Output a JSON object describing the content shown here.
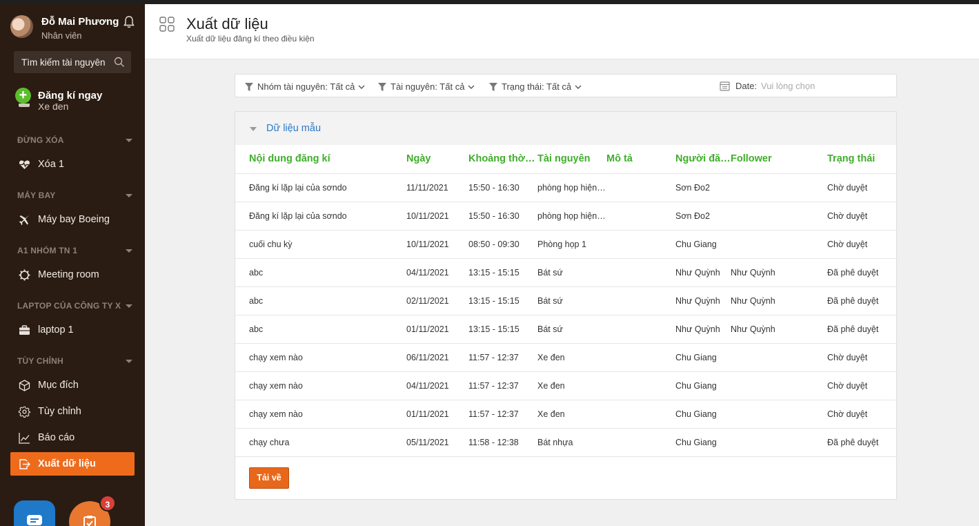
{
  "colors": {
    "sidebar_bg": "#2a1c12",
    "accent": "#ee6b1b",
    "header_green": "#3fae2a",
    "link_blue": "#2a79c9",
    "add_green": "#5bbd2b"
  },
  "user": {
    "name": "Đỗ Mai Phương",
    "role": "Nhân viên",
    "avatar_icon": "avatar-photo",
    "bell_icon": "bell-icon"
  },
  "sidebar": {
    "search_placeholder": "Tìm kiếm tài nguyên",
    "register_label": "Đăng kí ngay",
    "ghost_item_label": "Xe đen",
    "groups": [
      {
        "title": "ĐỪNG XÓA",
        "items": [
          {
            "label": "Xóa 1",
            "icon": "heartbeat-icon"
          }
        ]
      },
      {
        "title": "MÁY BAY",
        "items": [
          {
            "label": "Máy bay Boeing",
            "icon": "airplane-icon"
          }
        ]
      },
      {
        "title": "A1 NHÓM TN 1",
        "items": [
          {
            "label": "Meeting room",
            "icon": "gear-icon"
          }
        ]
      },
      {
        "title": "LAPTOP CỦA CÔNG TY X",
        "items": [
          {
            "label": "laptop 1",
            "icon": "briefcase-icon"
          }
        ]
      },
      {
        "title": "TÙY CHỈNH",
        "items": [
          {
            "label": "Mục đích",
            "icon": "cube-icon"
          },
          {
            "label": "Tùy chỉnh",
            "icon": "settings-icon"
          },
          {
            "label": "Báo cáo",
            "icon": "chart-icon"
          },
          {
            "label": "Xuất dữ liệu",
            "icon": "export-icon",
            "active": true
          }
        ]
      }
    ],
    "task_badge_count": "3"
  },
  "header": {
    "title": "Xuất dữ liệu",
    "subtitle": "Xuất dữ liệu đăng kí theo điều kiện"
  },
  "filters": {
    "group": "Nhóm tài nguyên: Tất cả",
    "resource": "Tài nguyên: Tất cả",
    "status": "Trạng thái: Tất cả",
    "date_label": "Date:",
    "date_placeholder": "Vui lòng chọn"
  },
  "panel": {
    "title": "Dữ liệu mẫu",
    "columns": [
      "Nội dung đăng kí",
      "Ngày",
      "Khoảng thời gian",
      "Tài nguyên",
      "Mô tả",
      "Người đăng kí",
      "Follower",
      "Trạng thái"
    ],
    "rows": [
      [
        "Đăng kí lặp lại của sơndo",
        "11/11/2021",
        "15:50 - 16:30",
        "phòng họp hiện đại",
        "",
        "Sơn Đo2",
        "",
        "Chờ duyệt"
      ],
      [
        "Đăng kí lặp lại của sơndo",
        "10/11/2021",
        "15:50 - 16:30",
        "phòng họp hiện đại",
        "",
        "Sơn Đo2",
        "",
        "Chờ duyệt"
      ],
      [
        "cuối chu kỳ",
        "10/11/2021",
        "08:50 - 09:30",
        "Phòng họp 1",
        "",
        "Chu Giang",
        "",
        "Chờ duyệt"
      ],
      [
        "abc",
        "04/11/2021",
        "13:15 - 15:15",
        "Bát sứ",
        "",
        "Như Quỳnh",
        "Như Quỳnh",
        "Đã phê duyệt"
      ],
      [
        "abc",
        "02/11/2021",
        "13:15 - 15:15",
        "Bát sứ",
        "",
        "Như Quỳnh",
        "Như Quỳnh",
        "Đã phê duyệt"
      ],
      [
        "abc",
        "01/11/2021",
        "13:15 - 15:15",
        "Bát sứ",
        "",
        "Như Quỳnh",
        "Như Quỳnh",
        "Đã phê duyệt"
      ],
      [
        "chạy xem nào",
        "06/11/2021",
        "11:57 - 12:37",
        "Xe đen",
        "",
        "Chu Giang",
        "",
        "Chờ duyệt"
      ],
      [
        "chạy xem nào",
        "04/11/2021",
        "11:57 - 12:37",
        "Xe đen",
        "",
        "Chu Giang",
        "",
        "Chờ duyệt"
      ],
      [
        "chạy xem nào",
        "01/11/2021",
        "11:57 - 12:37",
        "Xe đen",
        "",
        "Chu Giang",
        "",
        "Chờ duyệt"
      ],
      [
        "chạy chưa",
        "05/11/2021",
        "11:58 - 12:38",
        "Bát nhựa",
        "",
        "Chu Giang",
        "",
        "Đã phê duyệt"
      ]
    ],
    "download_label": "Tải về"
  }
}
